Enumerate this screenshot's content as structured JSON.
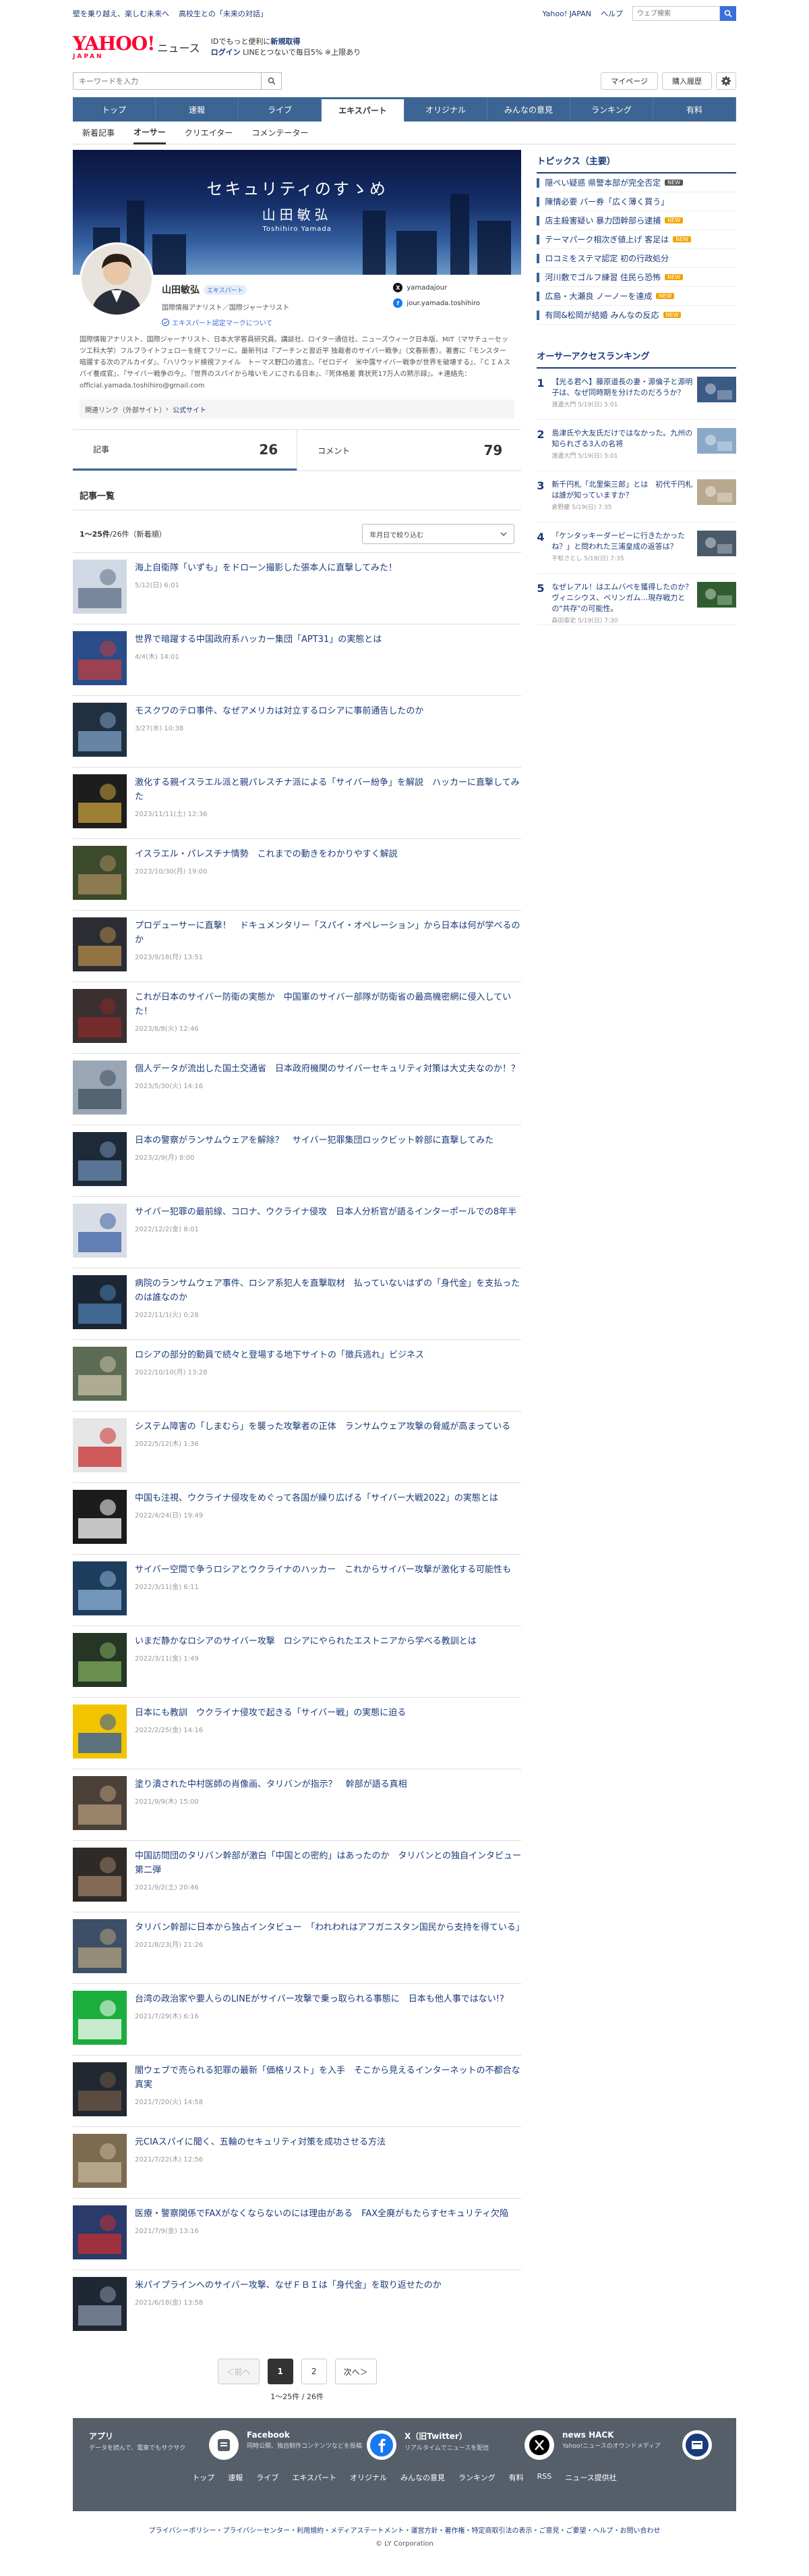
{
  "header": {
    "top_links": [
      "壁を乗り越え、楽しむ未来へ",
      "高校生との「未来の対話」"
    ],
    "right_links": [
      "Yahoo! JAPAN",
      "ヘルプ"
    ],
    "search_placeholder": "ウェブ検索",
    "logo_main": "YAHOO!",
    "logo_sub": "JAPAN",
    "section_name": "ニュース",
    "promo_line1_pre": "IDでもっと便利に",
    "promo_line1_link": "新規取得",
    "promo_line2_link": "ログイン",
    "promo_line2_text": "LINEとつないで毎日5% ※上限あり",
    "keyword_placeholder": "キーワードを入力",
    "mypage": "マイページ",
    "history": "購入履歴"
  },
  "nav": {
    "categories": [
      "トップ",
      "速報",
      "ライブ",
      "エキスパート",
      "オリジナル",
      "みんなの意見",
      "ランキング",
      "有料"
    ],
    "active_category": "エキスパート",
    "sub_tabs": [
      "新着記事",
      "オーサー",
      "クリエイター",
      "コメンテーター"
    ],
    "active_sub": "オーサー"
  },
  "author": {
    "banner_title": "セキュリティのすゝめ",
    "banner_name": "山田敏弘",
    "banner_romaji": "Toshihiro Yamada",
    "name": "山田敏弘",
    "badge": "エキスパート",
    "role": "国際情報アナリスト／国際ジャーナリスト",
    "mark_link": "エキスパート認定マークについて",
    "x_handle": "yamadajour",
    "fb_handle": "jour.yamada.toshihiro",
    "bio": "国際情報アナリスト、国際ジャーナリスト、日本大学客員研究員。講談社、ロイター通信社、ニューズウィーク日本版、MIT（マサチューセッツ工科大学）フルブライトフェローを経てフリーに。最新刊は『プーチンと習近平 独裁者のサイバー戦争』（文春新書）。著書に『モンスター　暗躍する次のアルカイダ』、『ハリウッド検視ファイル　トーマス野口の遺言』、『ゼロデイ　米中露サイバー戦争が世界を破壊する』、『ＣＩＡスパイ養成官』、『サイバー戦争の今』、『世界のスパイから喰いモノにされる日本』、『死体格差 異状死17万人の黙示録』。＊連絡先：official.yamada.toshihiro@gmail.com",
    "related_label": "関連リンク（外部サイト）",
    "related_link": "公式サイト"
  },
  "tabs": {
    "articles_label": "記事",
    "articles_count": "26",
    "comments_label": "コメント",
    "comments_count": "79"
  },
  "list": {
    "title": "記事一覧",
    "count_main": "1〜25件",
    "count_sub": "/26件（新着順）",
    "filter": "年月日で絞り込む",
    "articles": [
      {
        "title": "海上自衛隊「いずも」をドローン撮影した張本人に直撃してみた！",
        "date": "5/12(日) 6:01"
      },
      {
        "title": "世界で暗躍する中国政府系ハッカー集団「APT31」の実態とは",
        "date": "4/4(木) 14:01"
      },
      {
        "title": "モスクワのテロ事件、なぜアメリカは対立するロシアに事前通告したのか",
        "date": "3/27(水) 10:38"
      },
      {
        "title": "激化する親イスラエル派と親パレスチナ派による「サイバー紛争」を解説　ハッカーに直撃してみた",
        "date": "2023/11/11(土) 12:36"
      },
      {
        "title": "イスラエル・パレスチナ情勢　これまでの動きをわかりやすく解説",
        "date": "2023/10/30(月) 19:00"
      },
      {
        "title": "プロデューサーに直撃！　ドキュメンタリー「スパイ・オペレーション」から日本は何が学べるのか",
        "date": "2023/9/18(月) 13:51"
      },
      {
        "title": "これが日本のサイバー防衛の実態か　中国軍のサイバー部隊が防衛省の最高機密網に侵入していた！",
        "date": "2023/8/8(火) 12:46"
      },
      {
        "title": "個人データが流出した国土交通省　日本政府機関のサイバーセキュリティ対策は大丈夫なのか！？",
        "date": "2023/5/30(火) 14:16"
      },
      {
        "title": "日本の警察がランサムウェアを解除？　サイバー犯罪集団ロックビット幹部に直撃してみた",
        "date": "2023/2/9(月) 8:00"
      },
      {
        "title": "サイバー犯罪の最前線、コロナ、ウクライナ侵攻　日本人分析官が語るインターポールでの8年半",
        "date": "2022/12/2(金) 8:01"
      },
      {
        "title": "病院のランサムウェア事件、ロシア系犯人を直撃取材　払っていないはずの「身代金」を支払ったのは誰なのか",
        "date": "2022/11/1(火) 0:28"
      },
      {
        "title": "ロシアの部分的動員で続々と登場する地下サイトの「徴兵逃れ」ビジネス",
        "date": "2022/10/10(月) 13:28"
      },
      {
        "title": "システム障害の「しまむら」を襲った攻撃者の正体　ランサムウェア攻撃の脅威が高まっている",
        "date": "2022/5/12(木) 1:36"
      },
      {
        "title": "中国も注視、ウクライナ侵攻をめぐって各国が繰り広げる「サイバー大戦2022」の実態とは",
        "date": "2022/4/24(日) 19:49"
      },
      {
        "title": "サイバー空間で争うロシアとウクライナのハッカー　これからサイバー攻撃が激化する可能性も",
        "date": "2022/3/11(金) 6:11"
      },
      {
        "title": "いまだ静かなロシアのサイバー攻撃　ロシアにやられたエストニアから学べる教訓とは",
        "date": "2022/3/11(金) 1:49"
      },
      {
        "title": "日本にも教訓　ウクライナ侵攻で起きる「サイバー戦」の実態に迫る",
        "date": "2022/2/25(金) 14:16"
      },
      {
        "title": "塗り潰された中村医師の肖像画、タリバンが指示？　幹部が語る真相",
        "date": "2021/9/9(木) 15:00"
      },
      {
        "title": "中国訪問団のタリバン幹部が激白「中国との密約」はあったのか　タリバンとの独自インタビュー第二弾",
        "date": "2021/9/2(土) 20:46"
      },
      {
        "title": "タリバン幹部に日本から独占インタビュー　「われわれはアフガニスタン国民から支持を得ている」",
        "date": "2021/8/23(月) 21:26"
      },
      {
        "title": "台湾の政治家や要人らのLINEがサイバー攻撃で乗っ取られる事態に　日本も他人事ではない!?",
        "date": "2021/7/29(木) 6:16"
      },
      {
        "title": "闇ウェブで売られる犯罪の最新「価格リスト」を入手　そこから見えるインターネットの不都合な真実",
        "date": "2021/7/20(火) 14:58"
      },
      {
        "title": "元CIAスパイに聞く、五輪のセキュリティ対策を成功させる方法",
        "date": "2021/7/22(木) 12:56"
      },
      {
        "title": "医療・警察関係でFAXがなくならないのには理由がある　FAX全廃がもたらすセキュリティ欠陥",
        "date": "2021/7/9(金) 13:16"
      },
      {
        "title": "米パイプラインへのサイバー攻撃、なぜＦＢＩは「身代金」を取り返せたのか",
        "date": "2021/6/18(金) 13:58"
      }
    ]
  },
  "pager": {
    "prev": "＜前へ",
    "p1": "1",
    "p2": "2",
    "next": "次へ＞",
    "info": "1〜25件 / 26件"
  },
  "sidebar": {
    "topics_title": "トピックス（主要）",
    "topics": [
      {
        "text": "隠ぺい疑惑 県警本部が完全否定",
        "tag": "NEW"
      },
      {
        "text": "陳情必要 パー券「広く薄く買う」",
        "tag": ""
      },
      {
        "text": "店主殺害疑い 暴力団幹部ら逮捕",
        "tag": "NEW"
      },
      {
        "text": "テーマパーク相次ぎ値上げ 客足は",
        "tag": "NEW"
      },
      {
        "text": "ロコミをステマ認定 初の行政処分",
        "tag": ""
      },
      {
        "text": "河川敷でゴルフ練習 住民ら恐怖",
        "tag": "NEW"
      },
      {
        "text": "広島・大瀬良 ノーノーを達成",
        "tag": "NEW"
      },
      {
        "text": "有岡&松岡が結婚 みんなの反応",
        "tag": "NEW"
      }
    ],
    "ranking_title": "オーサーアクセスランキング",
    "ranking": [
      {
        "no": "1",
        "text": "【光る君へ】藤原道長の妻・源倫子と源明子は、なぜ同時期を分けたのだろうか？",
        "meta": "渡邊大門 5/19(日) 5:01"
      },
      {
        "no": "2",
        "text": "島津氏や大友氏だけではなかった。九州の知られざる3人の名将",
        "meta": "渡邊大門 5/19(日) 5:01"
      },
      {
        "no": "3",
        "text": "新千円札「北里柴三郎」とは　初代千円札は誰が知っていますか？",
        "meta": "倉野慶 5/19(日) 7:35"
      },
      {
        "no": "4",
        "text": "「ケンタッキーダービーに行きたかったね？」と問われた三浦皇成の返答は？",
        "meta": "平松さとし 5/19(日) 7:35"
      },
      {
        "no": "5",
        "text": "なぜレアル！はエムバペを獲得したのか？ヴィニシウス、ベリンガム…現存戦力との\"共存\"の可能性。",
        "meta": "森田泰史 5/19(日) 7:30"
      }
    ]
  },
  "footer": {
    "apps": [
      {
        "title": "アプリ",
        "desc": "データを読んで、電車でもサクサク"
      },
      {
        "title": "Facebook",
        "desc": "同時公開、独自制作コンテンツなどを投稿"
      },
      {
        "title": "X（旧Twitter）",
        "desc": "リアルタイムでニュースを配信"
      },
      {
        "title": "news HACK",
        "desc": "Yahoo!ニュースのオウンドメディア"
      }
    ],
    "nav": [
      "トップ",
      "速報",
      "ライブ",
      "エキスパート",
      "オリジナル",
      "みんなの意見",
      "ランキング",
      "有料",
      "RSS",
      "ニュース提供社"
    ],
    "links": "プライバシーポリシー・プライバシーセンター・利用規約・メディアステートメント・運営方針・著作権・特定商取引法の表示・ご意見・ご要望・ヘルプ・お問い合わせ",
    "copyright": "© LY Corporation"
  }
}
